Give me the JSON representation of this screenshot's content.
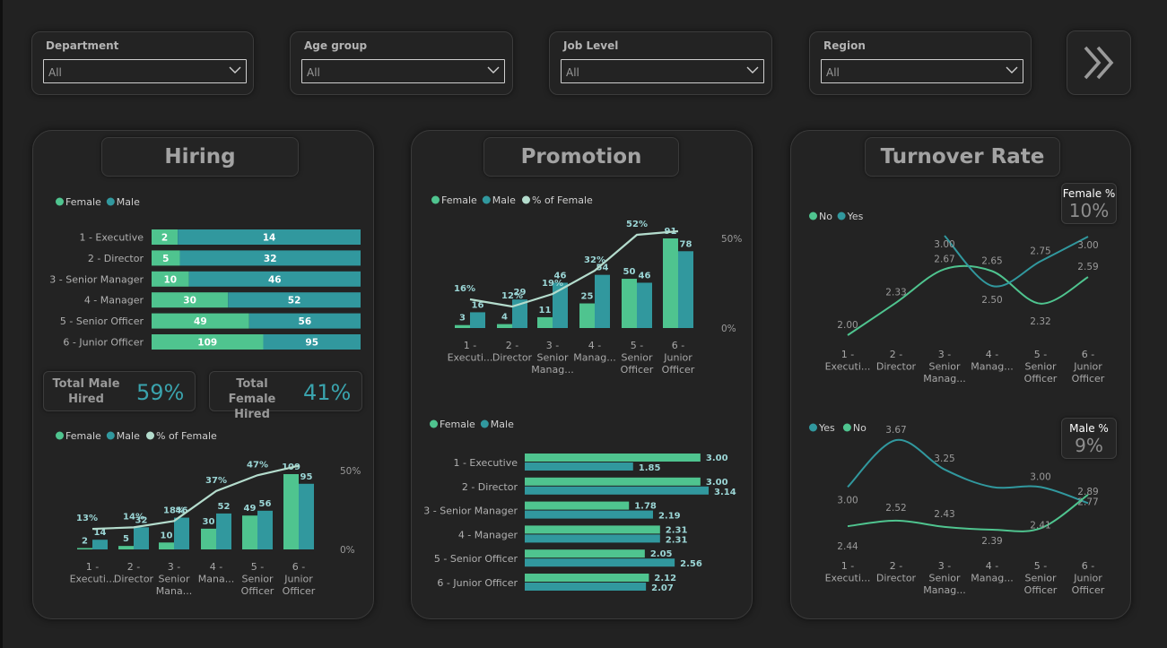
{
  "filters": [
    {
      "label": "Department",
      "value": "All"
    },
    {
      "label": "Age group",
      "value": "All"
    },
    {
      "label": "Job Level",
      "value": "All"
    },
    {
      "label": "Region",
      "value": "All"
    }
  ],
  "nav_icon": "double-chevron-right-icon",
  "colors": {
    "female": "#4fc48f",
    "male": "#31989e",
    "pct_line": "#b4dccd",
    "background": "#222222",
    "panel": "#232323"
  },
  "hiring": {
    "title": "Hiring",
    "kpi_male": {
      "label": "Total Male Hired",
      "value": "59%"
    },
    "kpi_female": {
      "label": "Total Female Hired",
      "value": "41%"
    }
  },
  "promotion": {
    "title": "Promotion"
  },
  "turnover": {
    "title": "Turnover Rate",
    "female_badge": {
      "label": "Female %",
      "value": "10%"
    },
    "male_badge": {
      "label": "Male %",
      "value": "9%"
    }
  },
  "chart_data": [
    {
      "id": "hiring_stacked",
      "type": "bar",
      "orientation": "horizontal-stacked",
      "legend": [
        "Female",
        "Male"
      ],
      "categories": [
        "1 - Executive",
        "2 - Director",
        "3 - Senior Manager",
        "4 - Manager",
        "5 - Senior Officer",
        "6 - Junior Officer"
      ],
      "series": [
        {
          "name": "Female",
          "values": [
            2,
            5,
            10,
            30,
            49,
            109
          ]
        },
        {
          "name": "Male",
          "values": [
            14,
            32,
            46,
            52,
            56,
            95
          ]
        }
      ]
    },
    {
      "id": "hiring_combo",
      "type": "bar",
      "legend": [
        "Female",
        "Male",
        "% of Female"
      ],
      "categories": [
        "1 - Executi...",
        "2 - Director",
        "3 - Senior Mana...",
        "4 - Mana...",
        "5 - Senior Officer",
        "6 - Junior Officer"
      ],
      "series": [
        {
          "name": "Female",
          "values": [
            2,
            5,
            10,
            30,
            49,
            109
          ]
        },
        {
          "name": "Male",
          "values": [
            14,
            32,
            46,
            52,
            56,
            95
          ]
        },
        {
          "name": "% of Female",
          "values": [
            13,
            14,
            18,
            37,
            47,
            53
          ],
          "labels": [
            "13%",
            "14%",
            "18%",
            "37%",
            "47%",
            ""
          ]
        }
      ],
      "y2_ticks": [
        "0%",
        "50%"
      ]
    },
    {
      "id": "promotion_combo",
      "type": "bar",
      "legend": [
        "Female",
        "Male",
        "% of Female"
      ],
      "categories": [
        "1 - Executi...",
        "2 - Director",
        "3 - Senior Manag...",
        "4 - Manag...",
        "5 - Senior Officer",
        "6 - Junior Officer"
      ],
      "series": [
        {
          "name": "Female",
          "values": [
            3,
            4,
            11,
            25,
            50,
            91
          ]
        },
        {
          "name": "Male",
          "values": [
            16,
            29,
            46,
            54,
            46,
            78
          ]
        },
        {
          "name": "% of Female",
          "values": [
            16,
            12,
            19,
            32,
            52,
            54
          ],
          "labels": [
            "16%",
            "12%",
            "19%",
            "32%",
            "52%",
            ""
          ]
        }
      ],
      "y2_ticks": [
        "0%",
        "50%"
      ]
    },
    {
      "id": "promotion_avg",
      "type": "bar",
      "orientation": "horizontal-clustered",
      "legend": [
        "Female",
        "Male"
      ],
      "categories": [
        "1 - Executive",
        "2 - Director",
        "3 - Senior Manager",
        "4 - Manager",
        "5 - Senior Officer",
        "6 - Junior Officer"
      ],
      "series": [
        {
          "name": "Female",
          "values": [
            3.0,
            3.0,
            1.78,
            2.31,
            2.05,
            2.12
          ],
          "labels": [
            "3.00",
            "3.00",
            "1.78",
            "2.31",
            "2.05",
            "2.12"
          ]
        },
        {
          "name": "Male",
          "values": [
            1.85,
            3.14,
            2.19,
            2.31,
            2.56,
            2.07
          ],
          "labels": [
            "1.85",
            "3.14",
            "2.19",
            "2.31",
            "2.56",
            "2.07"
          ]
        }
      ]
    },
    {
      "id": "turnover_female",
      "type": "line",
      "legend": [
        "No",
        "Yes"
      ],
      "categories": [
        "1 - Executi...",
        "2 - Director",
        "3 - Senior Manag...",
        "4 - Manag...",
        "5 - Senior Officer",
        "6 - Junior Officer"
      ],
      "series": [
        {
          "name": "No",
          "values": [
            2.0,
            2.33,
            2.67,
            2.65,
            2.32,
            2.59
          ],
          "labels": [
            "2.00",
            "2.33",
            "2.67",
            "2.65",
            "2.32",
            "2.59"
          ]
        },
        {
          "name": "Yes",
          "values": [
            null,
            null,
            3.0,
            2.5,
            2.75,
            3.0
          ],
          "labels": [
            "",
            "",
            "3.00",
            "2.50",
            "2.75",
            "3.00"
          ]
        }
      ]
    },
    {
      "id": "turnover_male",
      "type": "line",
      "legend": [
        "Yes",
        "No"
      ],
      "categories": [
        "1 - Executi...",
        "2 - Director",
        "3 - Senior Manag...",
        "4 - Manag...",
        "5 - Senior Officer",
        "6 - Junior Officer"
      ],
      "series": [
        {
          "name": "Yes",
          "values": [
            3.0,
            3.67,
            3.25,
            3.0,
            3.0,
            2.77
          ],
          "labels": [
            "3.00",
            "3.67",
            "3.25",
            "",
            "3.00",
            "2.77"
          ]
        },
        {
          "name": "No",
          "values": [
            2.44,
            2.52,
            2.43,
            2.39,
            2.41,
            2.89
          ],
          "labels": [
            "2.44",
            "2.52",
            "2.43",
            "2.39",
            "2.41",
            "2.89"
          ]
        }
      ]
    }
  ]
}
